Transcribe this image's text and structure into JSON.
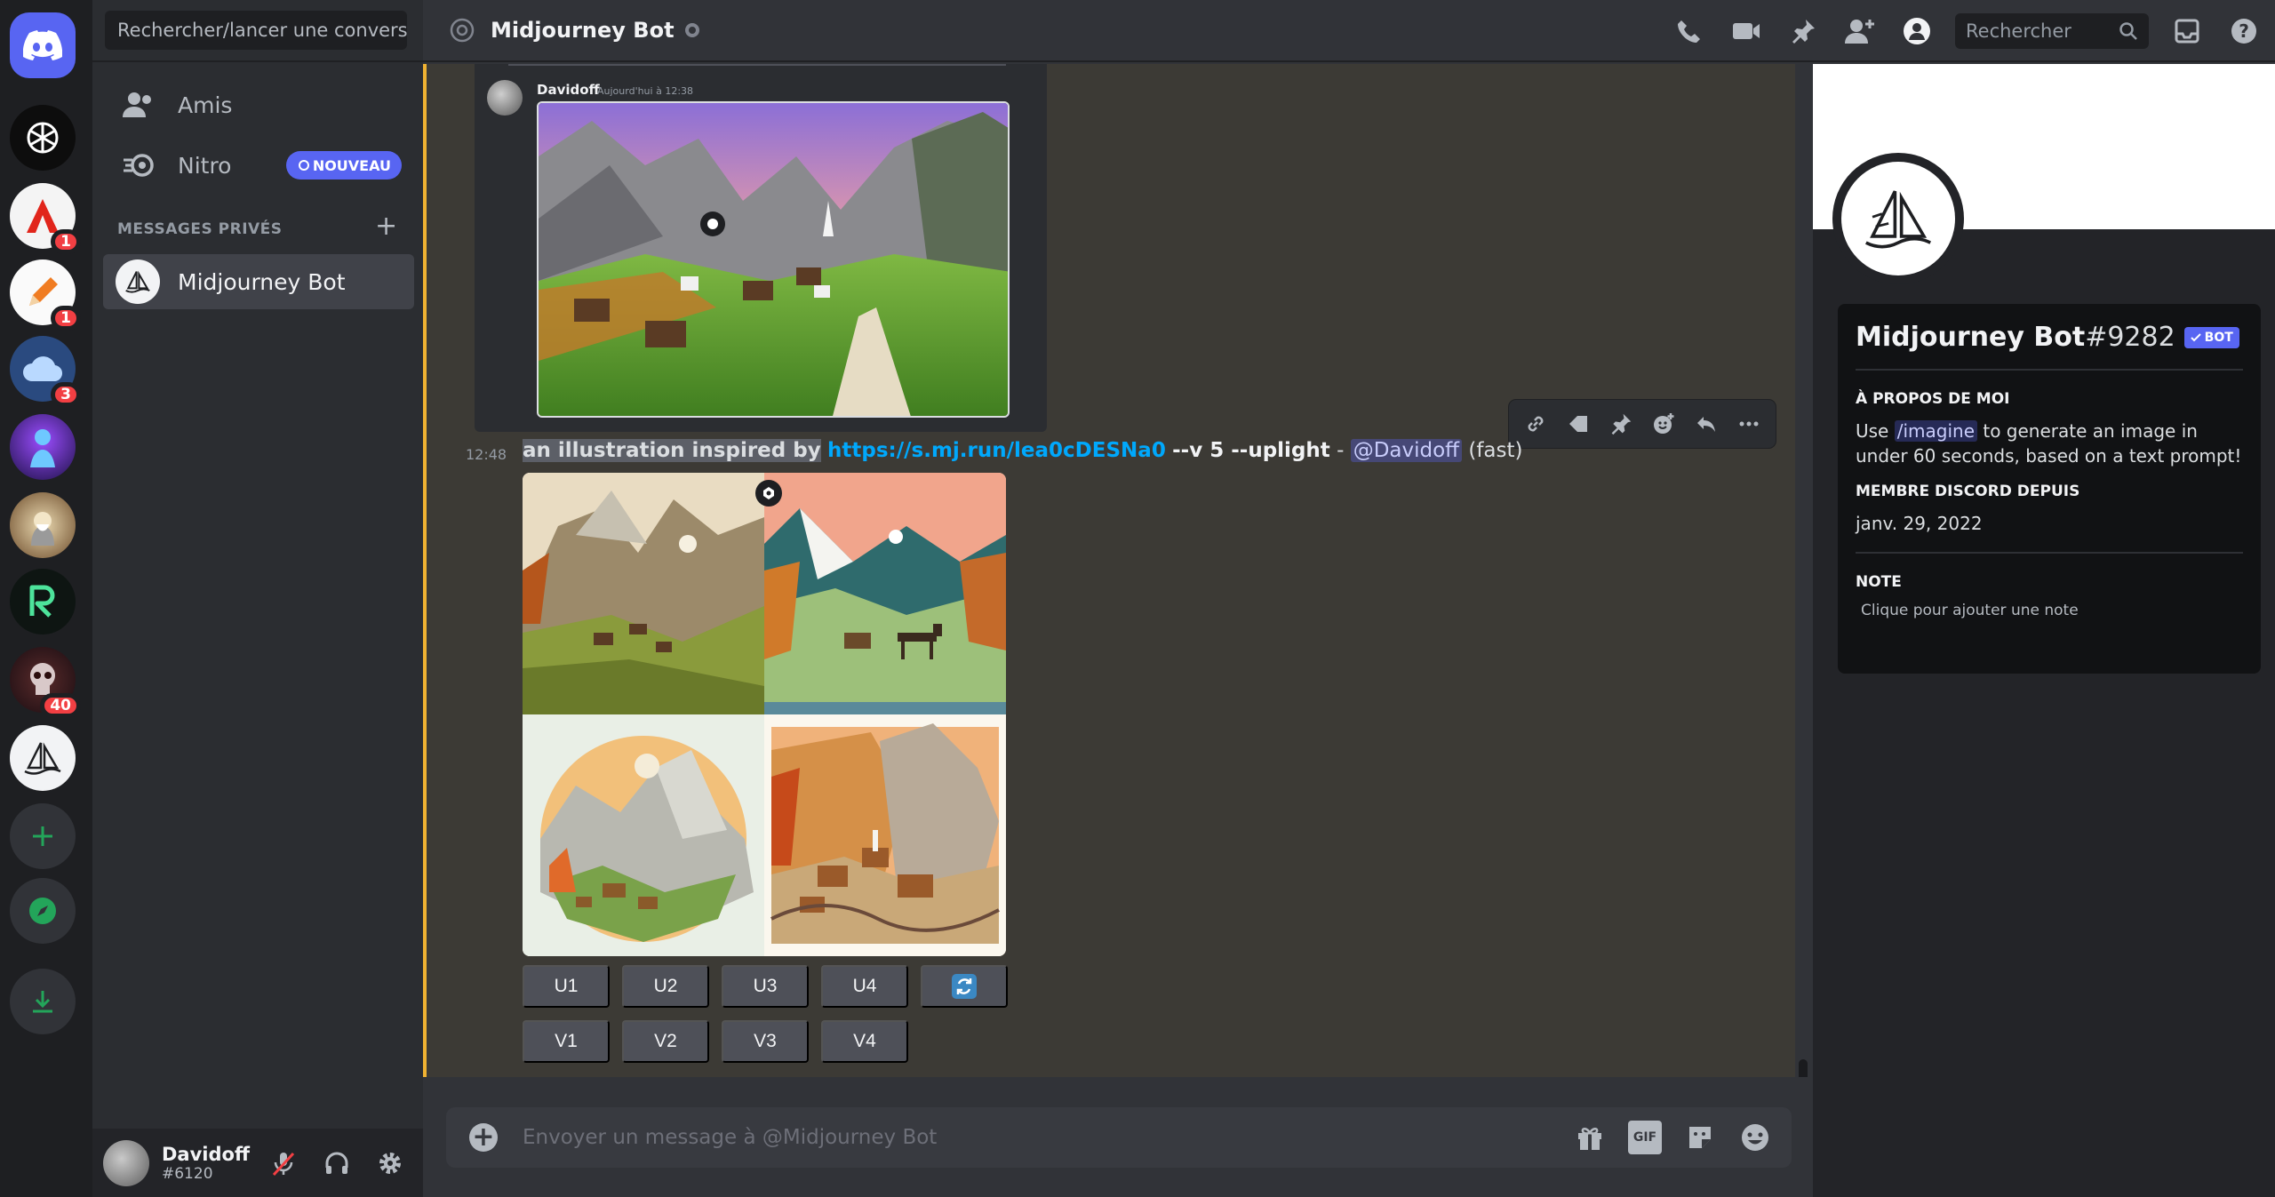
{
  "servers": [
    {
      "name": "discord-home"
    },
    {
      "name": "openai"
    },
    {
      "name": "adobe",
      "badge": "1"
    },
    {
      "name": "pencil",
      "badge": "1"
    },
    {
      "name": "cloud",
      "badge": "3"
    },
    {
      "name": "neon-figure"
    },
    {
      "name": "wizard"
    },
    {
      "name": "r-logo"
    },
    {
      "name": "skull",
      "badge": "40"
    },
    {
      "name": "midjourney"
    }
  ],
  "dm_sidebar": {
    "search_placeholder": "Rechercher/lancer une conversa...",
    "friends_label": "Amis",
    "nitro_label": "Nitro",
    "nitro_badge": "NOUVEAU",
    "section_heading": "MESSAGES PRIVÉS",
    "active_dm": "Midjourney Bot"
  },
  "user": {
    "name": "Davidoff",
    "tag": "#6120"
  },
  "header": {
    "title": "Midjourney Bot",
    "search_placeholder": "Rechercher"
  },
  "previous_message": {
    "author": "Davidoff",
    "time": "Aujourd'hui à 12:38"
  },
  "message": {
    "time": "12:48",
    "prompt": "an illustration inspired by",
    "link": "https://s.mj.run/lea0cDESNa0",
    "params": "--v 5 --uplight",
    "dash": " - ",
    "mention": "@Davidoff",
    "mode": " (fast)"
  },
  "buttons": {
    "upscale": [
      "U1",
      "U2",
      "U3",
      "U4"
    ],
    "variation": [
      "V1",
      "V2",
      "V3",
      "V4"
    ]
  },
  "composer": {
    "placeholder": "Envoyer un message à @Midjourney Bot",
    "gif_label": "GIF"
  },
  "profile": {
    "name": "Midjourney Bot",
    "discriminator": "#9282",
    "bot_tag": "BOT",
    "about_heading": "À PROPOS DE MOI",
    "about_pre": "Use ",
    "about_cmd": "/imagine",
    "about_post": " to generate an image in under 60 seconds, based on a text prompt!",
    "member_heading": "MEMBRE DISCORD DEPUIS",
    "member_since": "janv. 29, 2022",
    "note_heading": "NOTE",
    "note_placeholder": "Clique pour ajouter une note"
  },
  "colors": {
    "blurple": "#5865f2",
    "mention_bar": "#f0b232",
    "link": "#00a8fc",
    "badge_red": "#f23f43"
  }
}
